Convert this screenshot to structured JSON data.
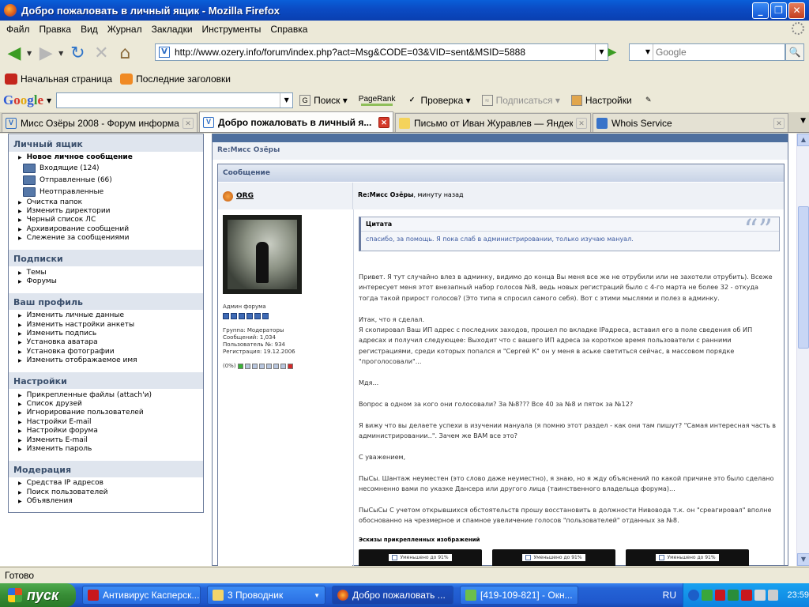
{
  "window": {
    "title": "Добро пожаловать в личный ящик - Mozilla Firefox"
  },
  "menu": [
    "Файл",
    "Правка",
    "Вид",
    "Журнал",
    "Закладки",
    "Инструменты",
    "Справка"
  ],
  "nav": {
    "url": "http://www.ozery.info/forum/index.php?act=Msg&CODE=03&VID=sent&MSID=5888",
    "search_placeholder": "Google"
  },
  "bookmarks": [
    "Начальная страница",
    "Последние заголовки"
  ],
  "google_toolbar": {
    "logo": "Google",
    "buttons": {
      "search": "Поиск",
      "pagerank": "PageRank",
      "check": "Проверка",
      "subscribe": "Подписаться",
      "settings": "Настройки"
    }
  },
  "tabs": [
    {
      "label": "Мисс Озёры 2008 - Форум информац..."
    },
    {
      "label": "Добро пожаловать в личный я..."
    },
    {
      "label": "Письмо от Иван Журавлев — Яндек..."
    },
    {
      "label": "Whois Service"
    }
  ],
  "sidebar": {
    "sections": [
      {
        "title": "Личный ящик"
      },
      {
        "title": "Подписки"
      },
      {
        "title": "Ваш профиль"
      },
      {
        "title": "Настройки"
      },
      {
        "title": "Модерация"
      }
    ],
    "mailbox": {
      "new_message": "Новое личное сообщение",
      "folders": [
        "Входящие (124)",
        "Отправленные (66)",
        "Неотправленные"
      ],
      "links": [
        "Очистка папок",
        "Изменить директории",
        "Черный список ЛС",
        "Архивирование сообщений",
        "Слежение за сообщениями"
      ]
    },
    "subscriptions": [
      "Темы",
      "Форумы"
    ],
    "profile": [
      "Изменить личные данные",
      "Изменить настройки анкеты",
      "Изменить подпись",
      "Установка аватара",
      "Установка фотографии",
      "Изменить отображаемое имя"
    ],
    "settings": [
      "Прикрепленные файлы (attach'и)",
      "Список друзей",
      "Игнорирование пользователей",
      "Настройки E-mail",
      "Настройки форума",
      "Изменить E-mail",
      "Изменить пароль"
    ],
    "moderation": [
      "Средства IP адресов",
      "Поиск пользователей",
      "Объявления"
    ]
  },
  "main": {
    "topic_title": "Re:Мисс Озёры",
    "message_header": "Сообщение",
    "author": "ORG",
    "subject": "Re:Мисс Озёры",
    "time": ", минуту назад",
    "author_info": {
      "title": "Админ форума",
      "group": "Группа: Модераторы",
      "posts": "Сообщений: 1,034",
      "user_no": "Пользователь №: 934",
      "registered": "Регистрация: 19.12.2006",
      "rep": "(0%)"
    },
    "quote": {
      "header": "Цитата",
      "text": "спасибо, за помощь. Я пока слаб в администрировании, только изучаю мануал."
    },
    "paragraphs": [
      "Привет. Я тут случайно влез в админку, видимо до конца Вы меня все же не отрубили или не захотели отрубить). Всеже интересует меня этот внезапный набор голосов №8, ведь новых регистраций было с 4-го марта не более 32 - откуда тогда такой прирост голосов? (Это типа я спросил самого себя). Вот с этими мыслями и полез в админку.",
      "Итак, что я сделал.\nЯ скопировал Ваш ИП адрес с последних заходов, прошел по вкладке IPадреса, вставил его в поле сведения об ИП адресах и получил следующее: Выходит что с вашего ИП адреса за короткое время пользователи с ранними регистрациями, среди которых попался и \"Сергей К\" он у меня в аське светиться сейчас, в массовом порядке \"проголосовали\"...",
      "Мдя...",
      "Вопрос в одном за кого они голосовали? За №8??? Все 40 за №8 и пяток за №12?",
      "Я вижу что вы делаете успехи в изучении мануала (я помню этот раздел - как они там пишут? \"Самая интересная часть в администрировании..\". Зачем же ВАМ все это?",
      "С уважением,",
      "ПыСы. Шантаж неуместен (это слово даже неуместно), я знаю, но я жду объяснений по какой причине это было сделано несомненно вами по указке Дансера или другого лица (таинственного владельца форума)...",
      "ПыСыСы С учетом открывшихся обстоятельств прошу восстановить в должности Нивовода т.к. он \"среагировал\" вполне обоснованно на чрезмерное и спамное увеличение голосов \"пользователей\" отданных за №8."
    ],
    "attachments_label": "Эскизы прикрепленных изображений",
    "thumb_label": "Уменьшено до 91%"
  },
  "status": "Готово",
  "taskbar": {
    "start": "пуск",
    "tasks": [
      "Антивирус Касперск...",
      "3 Проводник",
      "Добро пожаловать ...",
      "[419-109-821] - Окн..."
    ],
    "lang": "RU",
    "clock": "23:59"
  }
}
